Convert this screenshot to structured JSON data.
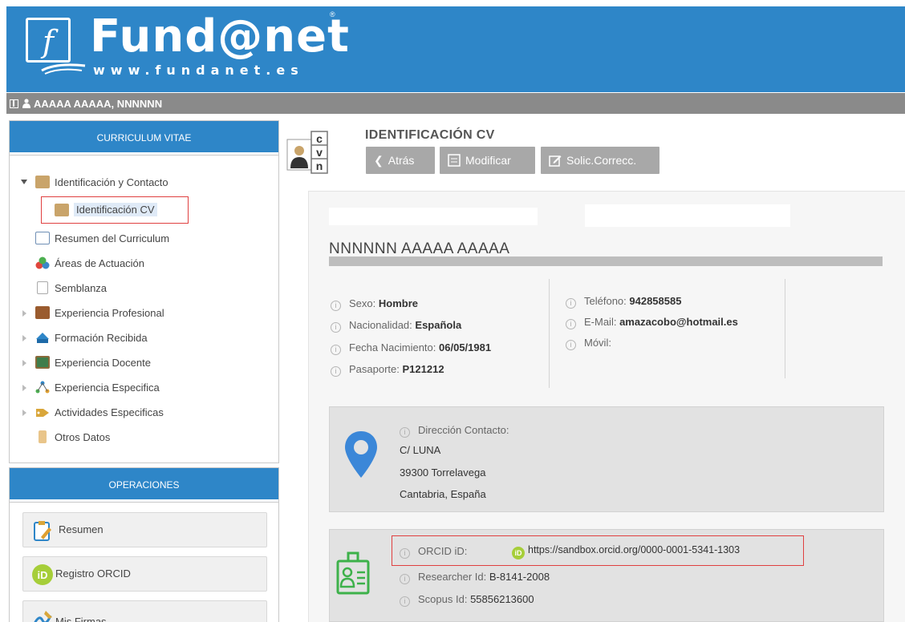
{
  "header": {
    "logo_letter": "f",
    "brand": "Fund@net",
    "registered": "®",
    "url": "www.fundanet.es"
  },
  "userbar": {
    "user_name": "AAAAA AAAAA, NNNNNN"
  },
  "sidebar": {
    "cv_title": "CURRICULUM VITAE",
    "tree": [
      {
        "label": "Identificación y Contacto",
        "state": "expanded"
      },
      {
        "label": "Identificación CV",
        "state": "selected"
      },
      {
        "label": "Resumen del Curriculum",
        "state": "leaf"
      },
      {
        "label": "Áreas de Actuación",
        "state": "leaf"
      },
      {
        "label": "Semblanza",
        "state": "leaf"
      },
      {
        "label": "Experiencia Profesional",
        "state": "collapsed"
      },
      {
        "label": "Formación Recibida",
        "state": "collapsed"
      },
      {
        "label": "Experiencia Docente",
        "state": "collapsed"
      },
      {
        "label": "Experiencia Especifica",
        "state": "collapsed"
      },
      {
        "label": "Actividades Especificas",
        "state": "collapsed"
      },
      {
        "label": "Otros Datos",
        "state": "leaf"
      }
    ],
    "ops_title": "OPERACIONES",
    "ops": [
      {
        "label": "Resumen"
      },
      {
        "label": "Registro ORCID"
      },
      {
        "label": "Mis Firmas"
      }
    ]
  },
  "main": {
    "cv_icon_letters": [
      "c",
      "v",
      "n"
    ],
    "title": "IDENTIFICACIÓN CV",
    "toolbar": {
      "back_label": "Atrás",
      "modify_label": "Modificar",
      "request_label": "Solic.Correcc."
    },
    "full_name": "NNNNNN AAAAA AAAAA",
    "personal": [
      {
        "label": "Sexo:",
        "value": "Hombre"
      },
      {
        "label": "Nacionalidad:",
        "value": "Española"
      },
      {
        "label": "Fecha Nacimiento:",
        "value": "06/05/1981"
      },
      {
        "label": "Pasaporte:",
        "value": "P121212"
      }
    ],
    "contact": [
      {
        "label": "Teléfono:",
        "value": "942858585"
      },
      {
        "label": "E-Mail:",
        "value": "amazacobo@hotmail.es"
      },
      {
        "label": "Móvil:",
        "value": ""
      }
    ],
    "address": {
      "label": "Dirección Contacto:",
      "lines": [
        "C/ LUNA",
        "39300 Torrelavega",
        "Cantabria, España"
      ]
    },
    "ids": {
      "orcid_label": "ORCID iD:",
      "orcid_badge": "iD",
      "orcid_url": "https://sandbox.orcid.org/0000-0001-5341-1303",
      "researcher_label": "Researcher Id:",
      "researcher_value": "B-8141-2008",
      "scopus_label": "Scopus Id:",
      "scopus_value": "55856213600"
    }
  },
  "colors": {
    "brand_blue": "#2e86c8",
    "user_bar_gray": "#8a8a8a",
    "button_gray": "#a8a8a8",
    "highlight_red": "#e04040",
    "orcid_green": "#a6ce39",
    "pin_blue": "#3b87d8",
    "idcard_green": "#3db14a"
  }
}
